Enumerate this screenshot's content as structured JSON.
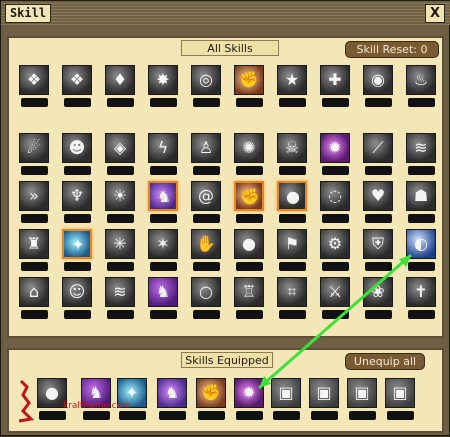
{
  "window": {
    "title": "Skill",
    "close_glyph": "X"
  },
  "all_skills": {
    "label": "All Skills"
  },
  "skill_reset": {
    "label": "Skill Reset",
    "value": "0"
  },
  "skills_equipped": {
    "label": "Skills Equipped"
  },
  "unequip_all": {
    "label": "Unequip all"
  },
  "watermark": "kralthemo.com",
  "top_row_icons": [
    "flame-drop-icon",
    "flame-drop-icon",
    "flame-shield-icon",
    "burst-icon",
    "swirl-icon",
    "fist-icon",
    "star-icon",
    "cross-arrows-icon",
    "spiral-icon",
    "flame-icon"
  ],
  "skill_rows": [
    [
      "comet-icon",
      "people-icon",
      "eye-icon",
      "lightning-icon",
      "figure-icon",
      "brain-icon",
      "skull-icon",
      "purple-burst-icon",
      "slash-icon",
      "wave-icon"
    ],
    [
      "dash-icon",
      "wings-icon",
      "sun-burst-icon",
      "dragon-icon",
      "tornado-icon",
      "fist-icon",
      "bomb-icon",
      "ring-icon",
      "heart-icon",
      "skull-mask-icon"
    ],
    [
      "figure-arms-icon",
      "crystal-icon",
      "splash-icon",
      "impact-icon",
      "hand-icon",
      "bomb-icon",
      "flag-icon",
      "gear-icon",
      "armor-icon",
      "blue-orb-icon"
    ],
    [
      "shell-icon",
      "crowd-icon",
      "wave-icon",
      "purple-dragon-icon",
      "orb-icon",
      "warrior-icon",
      "web-icon",
      "double-sword-icon",
      "wreath-icon",
      "cross-icon"
    ]
  ],
  "highlighted_slots": [
    "r1c3",
    "r1c5",
    "r1c6",
    "r2c1"
  ],
  "equipped": [
    {
      "icon": "bomb-icon",
      "locked": false
    },
    {
      "icon": "purple-dragon-icon",
      "locked": false
    },
    {
      "icon": "crystal-icon",
      "locked": false
    },
    {
      "icon": "dragon-icon",
      "locked": false
    },
    {
      "icon": "fist-icon",
      "locked": false
    },
    {
      "icon": "purple-burst-icon",
      "locked": false
    },
    {
      "icon": "lock-icon",
      "locked": true
    },
    {
      "icon": "lock-icon",
      "locked": true
    },
    {
      "icon": "lock-icon",
      "locked": true
    },
    {
      "icon": "lock-icon",
      "locked": true
    }
  ],
  "colors": {
    "highlight": "#e58624",
    "arrow": "#3ee03a",
    "panel": "#f3e7b7",
    "frame": "#6b5d44"
  }
}
